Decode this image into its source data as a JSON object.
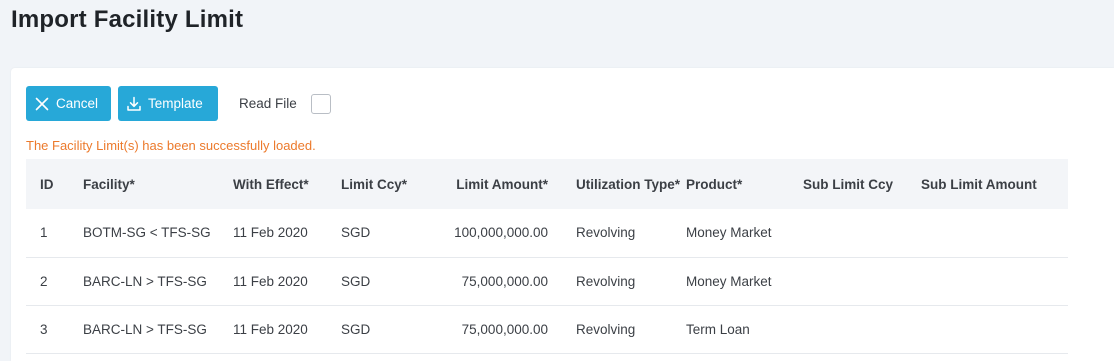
{
  "page": {
    "title": "Import Facility Limit"
  },
  "toolbar": {
    "cancel_label": "Cancel",
    "template_label": "Template",
    "read_file_label": "Read File",
    "read_file_checked": false
  },
  "status": {
    "message": "The Facility Limit(s) has been successfully loaded."
  },
  "table": {
    "headers": {
      "id": "ID",
      "facility": "Facility*",
      "with_effect": "With Effect*",
      "limit_ccy": "Limit Ccy*",
      "limit_amount": "Limit Amount*",
      "utilization_type": "Utilization Type*",
      "product": "Product*",
      "sub_limit_ccy": "Sub Limit Ccy",
      "sub_limit_amount": "Sub Limit Amount"
    },
    "rows": [
      {
        "id": "1",
        "facility": "BOTM-SG < TFS-SG",
        "with_effect": "11 Feb 2020",
        "limit_ccy": "SGD",
        "limit_amount": "100,000,000.00",
        "utilization_type": "Revolving",
        "product": "Money Market",
        "sub_limit_ccy": "",
        "sub_limit_amount": ""
      },
      {
        "id": "2",
        "facility": "BARC-LN > TFS-SG",
        "with_effect": "11 Feb 2020",
        "limit_ccy": "SGD",
        "limit_amount": "75,000,000.00",
        "utilization_type": "Revolving",
        "product": "Money Market",
        "sub_limit_ccy": "",
        "sub_limit_amount": ""
      },
      {
        "id": "3",
        "facility": "BARC-LN > TFS-SG",
        "with_effect": "11 Feb 2020",
        "limit_ccy": "SGD",
        "limit_amount": "75,000,000.00",
        "utilization_type": "Revolving",
        "product": "Term Loan",
        "sub_limit_ccy": "",
        "sub_limit_amount": ""
      }
    ]
  },
  "colors": {
    "primary_button": "#27a8d8",
    "success_text": "#ec7a2c",
    "page_background": "#f1f4f8",
    "header_row_background": "#f3f5f8"
  },
  "icons": {
    "cancel": "close-icon",
    "template": "download-icon"
  }
}
